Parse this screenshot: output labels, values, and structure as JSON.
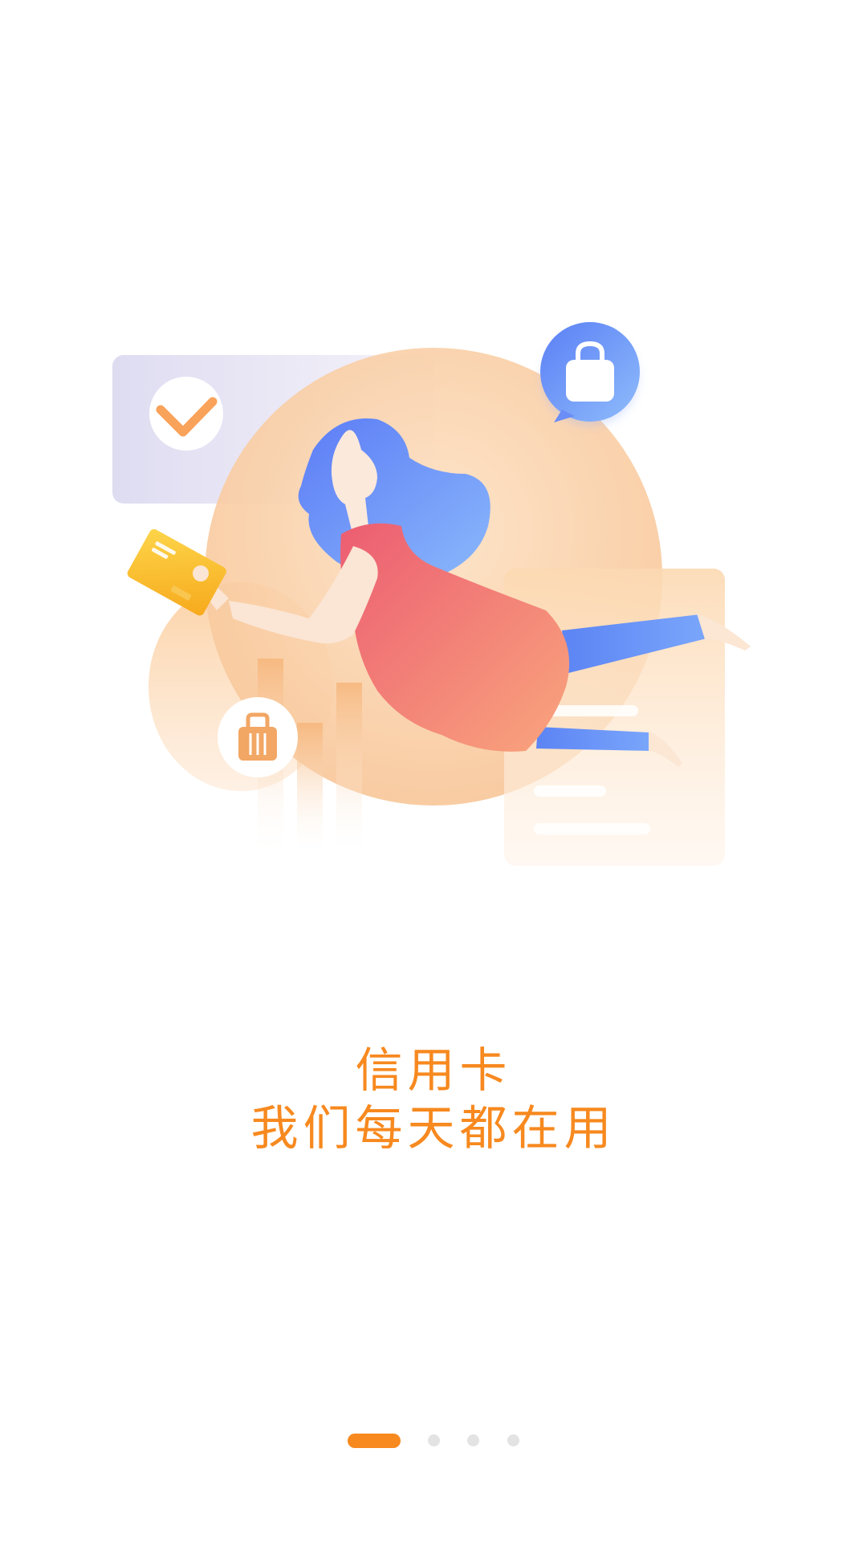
{
  "onboarding": {
    "title_line1": "信用卡",
    "title_line2": "我们每天都在用",
    "accent_color": "#f7891f",
    "pager": {
      "total": 4,
      "current": 1
    }
  },
  "illustration": {
    "icons": [
      "checkmark-icon",
      "shopping-bag-icon",
      "suitcase-icon",
      "credit-card-icon"
    ],
    "colors": {
      "orange_blob": "#fbd4ad",
      "blue_hair": "#6b8cf7",
      "red_dress": "#ee6675",
      "card_yellow": "#fbbf2a",
      "panel_lavender": "#dcdcf0"
    }
  }
}
